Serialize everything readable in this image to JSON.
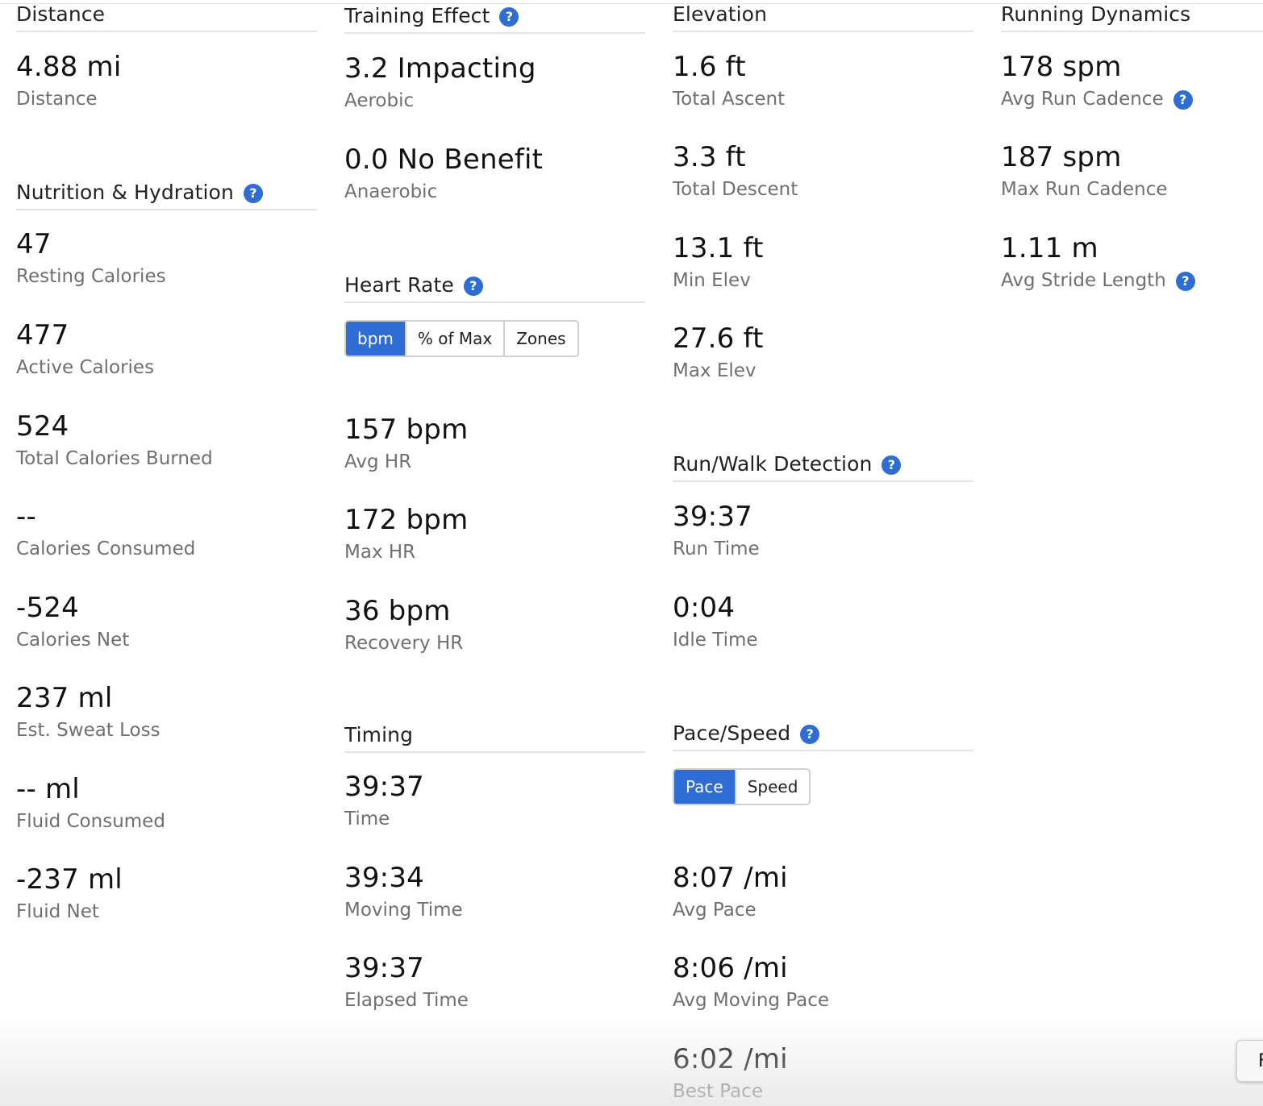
{
  "col1": {
    "distance": {
      "title": "Distance",
      "stats": [
        {
          "value": "4.88 mi",
          "label": "Distance"
        }
      ]
    },
    "nutrition": {
      "title": "Nutrition & Hydration",
      "stats": [
        {
          "value": "47",
          "label": "Resting Calories"
        },
        {
          "value": "477",
          "label": "Active Calories"
        },
        {
          "value": "524",
          "label": "Total Calories Burned"
        },
        {
          "value": "--",
          "label": "Calories Consumed"
        },
        {
          "value": "-524",
          "label": "Calories Net"
        },
        {
          "value": "237 ml",
          "label": "Est. Sweat Loss"
        },
        {
          "value": "-- ml",
          "label": "Fluid Consumed"
        },
        {
          "value": "-237 ml",
          "label": "Fluid Net"
        }
      ]
    }
  },
  "col2": {
    "training": {
      "title": "Training Effect",
      "stats": [
        {
          "value": "3.2 Impacting",
          "label": "Aerobic"
        },
        {
          "value": "0.0 No Benefit",
          "label": "Anaerobic"
        }
      ]
    },
    "heart_rate": {
      "title": "Heart Rate",
      "toggle": [
        "bpm",
        "% of Max",
        "Zones"
      ],
      "active_toggle": "bpm",
      "stats": [
        {
          "value": "157 bpm",
          "label": "Avg HR"
        },
        {
          "value": "172 bpm",
          "label": "Max HR"
        },
        {
          "value": "36 bpm",
          "label": "Recovery HR"
        }
      ]
    },
    "timing": {
      "title": "Timing",
      "stats": [
        {
          "value": "39:37",
          "label": "Time"
        },
        {
          "value": "39:34",
          "label": "Moving Time"
        },
        {
          "value": "39:37",
          "label": "Elapsed Time"
        }
      ]
    }
  },
  "col3": {
    "elevation": {
      "title": "Elevation",
      "stats": [
        {
          "value": "1.6 ft",
          "label": "Total Ascent"
        },
        {
          "value": "3.3 ft",
          "label": "Total Descent"
        },
        {
          "value": "13.1 ft",
          "label": "Min Elev"
        },
        {
          "value": "27.6 ft",
          "label": "Max Elev"
        }
      ]
    },
    "run_walk": {
      "title": "Run/Walk Detection",
      "stats": [
        {
          "value": "39:37",
          "label": "Run Time"
        },
        {
          "value": "0:04",
          "label": "Idle Time"
        }
      ]
    },
    "pace": {
      "title": "Pace/Speed",
      "toggle": [
        "Pace",
        "Speed"
      ],
      "active_toggle": "Pace",
      "stats": [
        {
          "value": "8:07 /mi",
          "label": "Avg Pace"
        },
        {
          "value": "8:06 /mi",
          "label": "Avg Moving Pace"
        },
        {
          "value": "6:02 /mi",
          "label": "Best Pace"
        }
      ]
    }
  },
  "col4": {
    "dynamics": {
      "title": "Running Dynamics",
      "stats": [
        {
          "value": "178 spm",
          "label": "Avg Run Cadence"
        },
        {
          "value": "187 spm",
          "label": "Max Run Cadence"
        },
        {
          "value": "1.11 m",
          "label": "Avg Stride Length"
        }
      ]
    }
  },
  "help_glyph": "?",
  "edge_button_label": "F",
  "colors": {
    "accent": "#2e6ed4",
    "label": "#6f6f6f",
    "divider": "#e3e3e3"
  }
}
